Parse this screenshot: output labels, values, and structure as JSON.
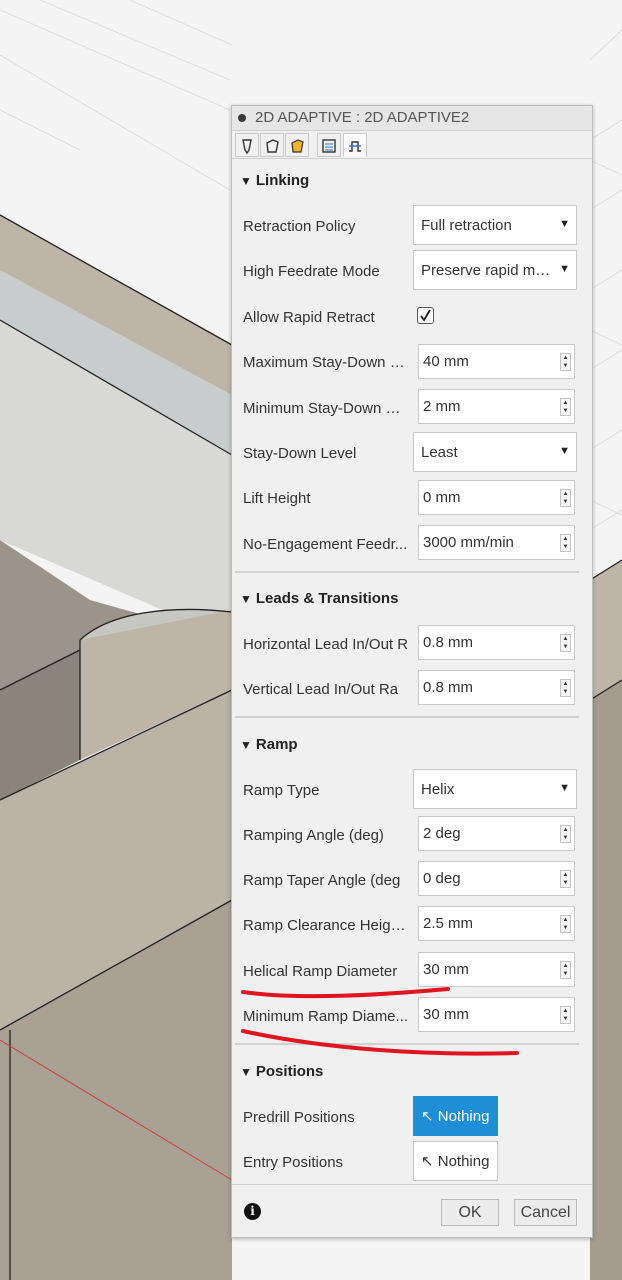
{
  "dialog": {
    "title": "2D ADAPTIVE : 2D ADAPTIVE2",
    "tabs": [
      {
        "icon": "tool-icon"
      },
      {
        "icon": "geometry-icon"
      },
      {
        "icon": "heights-icon"
      },
      {
        "icon": "passes-icon"
      },
      {
        "icon": "linking-icon",
        "active": true
      }
    ]
  },
  "linking": {
    "title": "Linking",
    "retraction_policy": {
      "label": "Retraction Policy",
      "value": "Full retraction"
    },
    "high_feedrate_mode": {
      "label": "High Feedrate Mode",
      "value": "Preserve rapid movement"
    },
    "allow_rapid_retract": {
      "label": "Allow Rapid Retract",
      "checked": true
    },
    "max_stay_down": {
      "label": "Maximum Stay-Down D...",
      "value": "40 mm"
    },
    "min_stay_down": {
      "label": "Minimum Stay-Down Cl...",
      "value": "2 mm"
    },
    "stay_down_level": {
      "label": "Stay-Down Level",
      "value": "Least"
    },
    "lift_height": {
      "label": "Lift Height",
      "value": "0 mm"
    },
    "no_engagement_feedrate": {
      "label": "No-Engagement Feedr...",
      "value": "3000 mm/min"
    }
  },
  "leads": {
    "title": "Leads & Transitions",
    "horizontal_lead": {
      "label": "Horizontal Lead In/Out R",
      "value": "0.8 mm"
    },
    "vertical_lead": {
      "label": "Vertical Lead In/Out Ra",
      "value": "0.8 mm"
    }
  },
  "ramp": {
    "title": "Ramp",
    "ramp_type": {
      "label": "Ramp Type",
      "value": "Helix"
    },
    "ramping_angle": {
      "label": "Ramping Angle (deg)",
      "value": "2 deg"
    },
    "ramp_taper_angle": {
      "label": "Ramp Taper Angle (deg",
      "value": "0 deg"
    },
    "ramp_clearance_height": {
      "label": "Ramp Clearance Heigh...",
      "value": "2.5 mm"
    },
    "helical_ramp_diameter": {
      "label": "Helical Ramp Diameter",
      "value": "30 mm"
    },
    "minimum_ramp_diameter": {
      "label": "Minimum Ramp Diame...",
      "value": "30 mm"
    }
  },
  "positions": {
    "title": "Positions",
    "predrill": {
      "label": "Predrill Positions",
      "value": "Nothing"
    },
    "entry": {
      "label": "Entry Positions",
      "value": "Nothing"
    }
  },
  "footer": {
    "ok": "OK",
    "cancel": "Cancel"
  },
  "colors": {
    "accent": "#1e8fd6",
    "annotation": "#e0151f",
    "model_face": "#bcb5a7"
  }
}
